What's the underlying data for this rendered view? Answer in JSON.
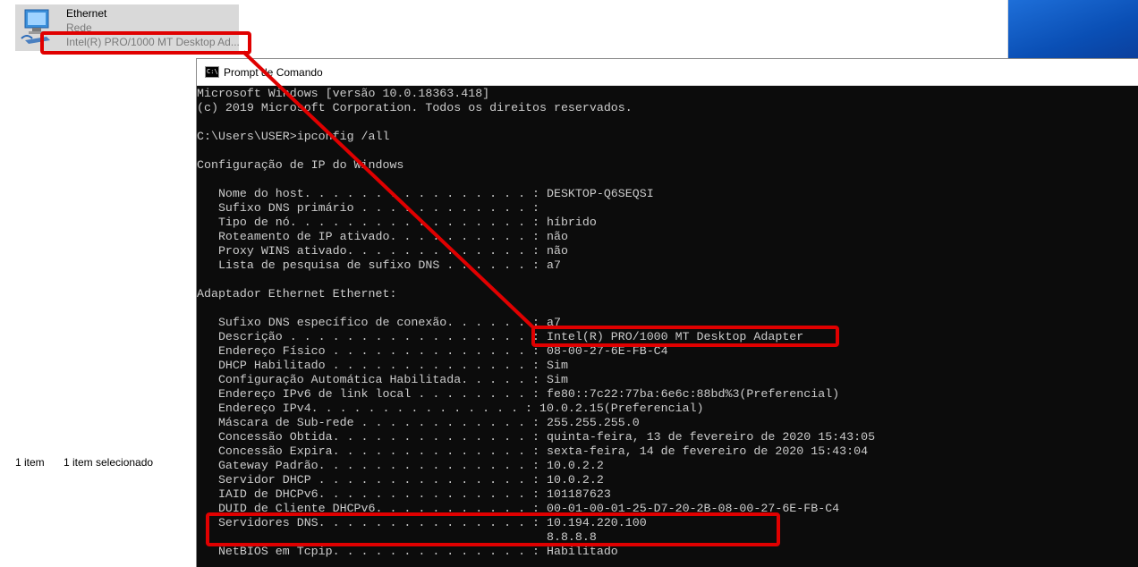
{
  "explorer": {
    "item": {
      "name": "Ethernet",
      "type": "Rede",
      "description": "Intel(R) PRO/1000 MT Desktop Ad..."
    },
    "status": {
      "count": "1 item",
      "selected": "1 item selecionado"
    }
  },
  "cmd": {
    "title": "Prompt de Comando",
    "icon_text": "C:\\",
    "lines": [
      "Microsoft Windows [versão 10.0.18363.418]",
      "(c) 2019 Microsoft Corporation. Todos os direitos reservados.",
      "",
      "C:\\Users\\USER>ipconfig /all",
      "",
      "Configuração de IP do Windows",
      "",
      "   Nome do host. . . . . . . . . . . . . . . . : DESKTOP-Q6SEQSI",
      "   Sufixo DNS primário . . . . . . . . . . . . :",
      "   Tipo de nó. . . . . . . . . . . . . . . . . : híbrido",
      "   Roteamento de IP ativado. . . . . . . . . . : não",
      "   Proxy WINS ativado. . . . . . . . . . . . . : não",
      "   Lista de pesquisa de sufixo DNS . . . . . . : a7",
      "",
      "Adaptador Ethernet Ethernet:",
      "",
      "   Sufixo DNS específico de conexão. . . . . . : a7",
      "   Descrição . . . . . . . . . . . . . . . . . : Intel(R) PRO/1000 MT Desktop Adapter",
      "   Endereço Físico . . . . . . . . . . . . . . : 08-00-27-6E-FB-C4",
      "   DHCP Habilitado . . . . . . . . . . . . . . : Sim",
      "   Configuração Automática Habilitada. . . . . : Sim",
      "   Endereço IPv6 de link local . . . . . . . . : fe80::7c22:77ba:6e6c:88bd%3(Preferencial)",
      "   Endereço IPv4. . . . . . . . . . . . . . . : 10.0.2.15(Preferencial)",
      "   Máscara de Sub-rede . . . . . . . . . . . . : 255.255.255.0",
      "   Concessão Obtida. . . . . . . . . . . . . . : quinta-feira, 13 de fevereiro de 2020 15:43:05",
      "   Concessão Expira. . . . . . . . . . . . . . : sexta-feira, 14 de fevereiro de 2020 15:43:04",
      "   Gateway Padrão. . . . . . . . . . . . . . . : 10.0.2.2",
      "   Servidor DHCP . . . . . . . . . . . . . . . : 10.0.2.2",
      "   IAID de DHCPv6. . . . . . . . . . . . . . . : 101187623",
      "   DUID de Cliente DHCPv6. . . . . . . . . . . : 00-01-00-01-25-D7-20-2B-08-00-27-6E-FB-C4",
      "   Servidores DNS. . . . . . . . . . . . . . . : 10.194.220.100",
      "                                                 8.8.8.8",
      "   NetBIOS em Tcpip. . . . . . . . . . . . . . : Habilitado"
    ]
  },
  "colors": {
    "annotation": "#e00000",
    "console_bg": "#0c0c0c",
    "console_fg": "#cccccc"
  }
}
